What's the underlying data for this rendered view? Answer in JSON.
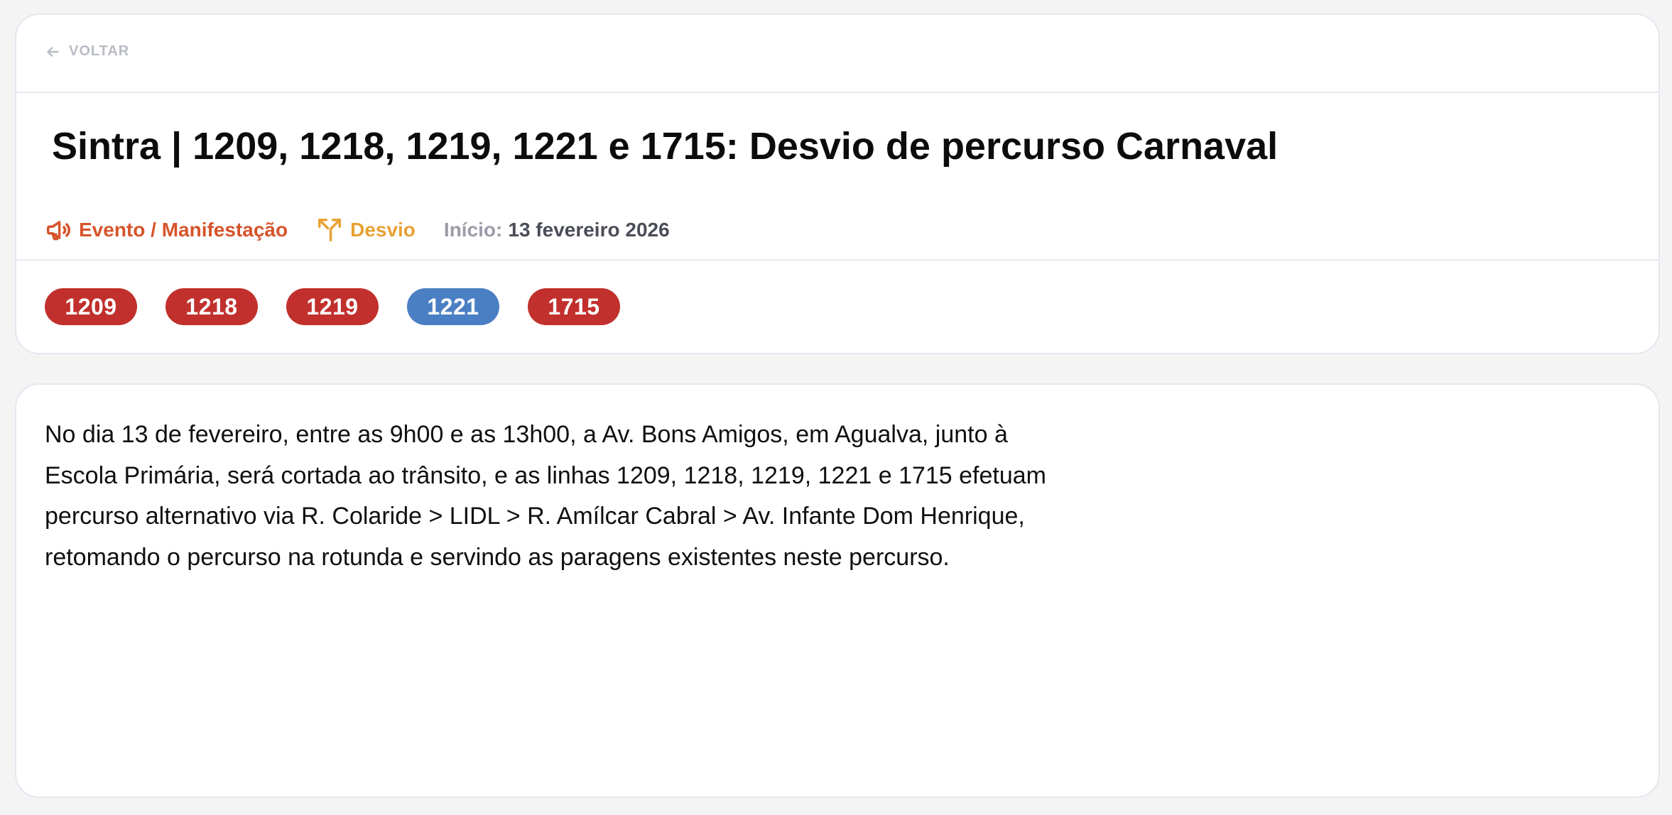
{
  "back": {
    "label": "VOLTAR",
    "icon": "arrow-left-icon"
  },
  "title": "Sintra | 1209, 1218, 1219, 1221 e 1715: Desvio de percurso Carnaval",
  "meta": {
    "event": {
      "label": "Evento / Manifestação",
      "icon": "megaphone-icon",
      "color": "#d6542b"
    },
    "detour": {
      "label": "Desvio",
      "icon": "detour-icon",
      "color": "#e8a134"
    },
    "start": {
      "label": "Início:",
      "value": "13 fevereiro 2026"
    }
  },
  "lines": [
    {
      "label": "1209",
      "color": "#c1302c"
    },
    {
      "label": "1218",
      "color": "#c1302c"
    },
    {
      "label": "1219",
      "color": "#c1302c"
    },
    {
      "label": "1221",
      "color": "#4b7fc4"
    },
    {
      "label": "1715",
      "color": "#c1302c"
    }
  ],
  "description": "No dia 13 de fevereiro, entre as 9h00 e as 13h00, a Av. Bons Amigos, em Agualva, junto à Escola Primária, será cortada ao trânsito, e as linhas 1209, 1218, 1219, 1221 e 1715 efetuam percurso alternativo via R. Colaride > LIDL > R. Amílcar Cabral > Av. Infante Dom Henrique, retomando o percurso na rotunda e servindo as paragens existentes neste percurso."
}
